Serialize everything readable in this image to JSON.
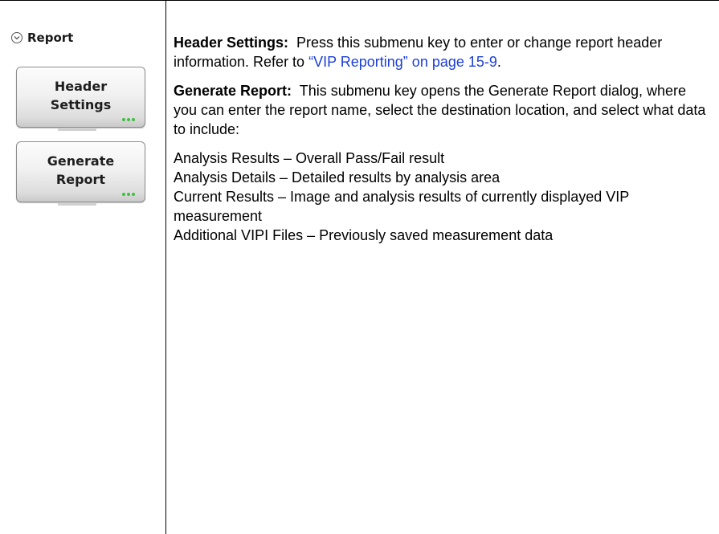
{
  "menu": {
    "title": "Report",
    "keys": [
      {
        "line1": "Header",
        "line2": "Settings"
      },
      {
        "line1": "Generate",
        "line2": "Report"
      }
    ]
  },
  "content": {
    "p1": {
      "term": "Header Settings:",
      "text": "  Press this submenu key to enter or change report header information. Refer to ",
      "link": "“VIP Reporting” on page 15-9",
      "end": "."
    },
    "p2": {
      "term": "Generate Report:",
      "text": "  This submenu key opens the Generate Report dialog, where you can enter the report name, select the destination location, and select what data to include:"
    },
    "items": [
      "Analysis Results – Overall Pass/Fail result",
      "Analysis Details – Detailed results by analysis area",
      "Current Results – Image and analysis results of currently displayed VIP measurement",
      "Additional VIPI Files – Previously saved measurement data"
    ]
  },
  "colors": {
    "link": "#1c3fd6",
    "indicator_dots": "#3fc13f"
  },
  "icons": [
    "chevron-down-circle-icon",
    "more-dots-icon"
  ]
}
